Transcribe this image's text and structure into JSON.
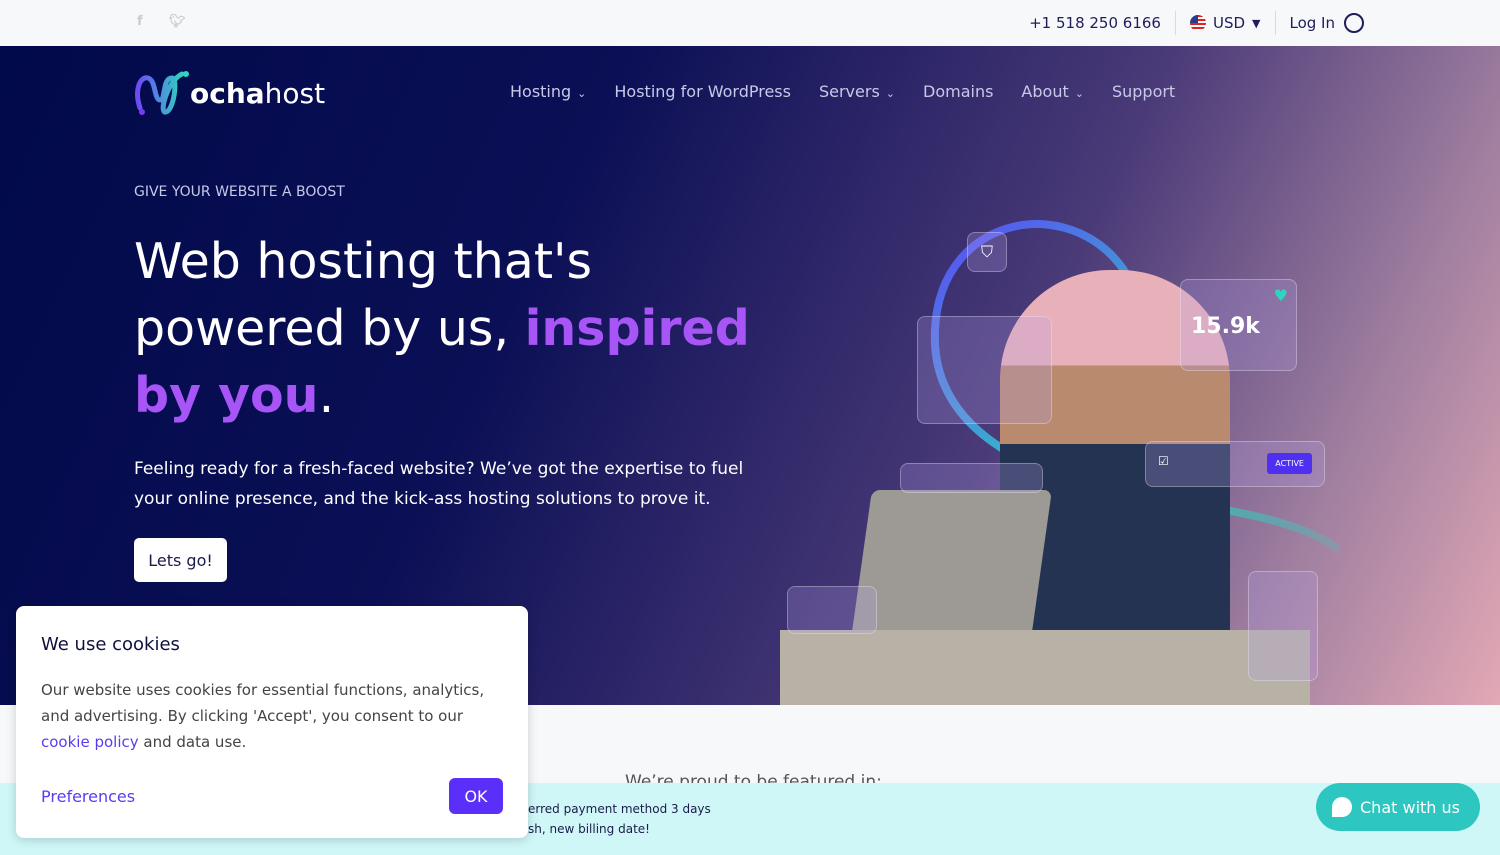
{
  "topbar": {
    "phone": "+1 518 250 6166",
    "currency": "USD",
    "login": "Log In",
    "social": [
      "facebook-icon",
      "twitter-icon"
    ]
  },
  "brand": {
    "name_bold": "ocha",
    "name_light": "host"
  },
  "nav": [
    {
      "label": "Hosting",
      "dropdown": true
    },
    {
      "label": "Hosting for WordPress",
      "dropdown": false
    },
    {
      "label": "Servers",
      "dropdown": true
    },
    {
      "label": "Domains",
      "dropdown": false
    },
    {
      "label": "About",
      "dropdown": true
    },
    {
      "label": "Support",
      "dropdown": false
    }
  ],
  "hero": {
    "eyebrow": "GIVE YOUR WEBSITE A BOOST",
    "title_1": "Web hosting that's powered by us, ",
    "title_accent": "inspired by you",
    "title_end": ".",
    "lead": "Feeling ready for a fresh-faced website? We’ve got the expertise to fuel your online presence, and the kick-ass hosting solutions to prove it.",
    "cta": "Lets go!",
    "stat": "15.9k",
    "badge": "ACTIVE"
  },
  "featured": "We’re proud to be featured in:",
  "banner": {
    "line1": "erred payment method 3 days",
    "line2": "sh, new billing date!"
  },
  "cookie": {
    "title": "We use cookies",
    "text": "Our website uses cookies for essential functions, analytics, and advertising. By clicking 'Accept', you consent to our ",
    "link": "cookie policy",
    "text_end": " and data use.",
    "preferences": "Preferences",
    "ok": "OK"
  },
  "chat": {
    "label": "Chat with us"
  },
  "colors": {
    "accent": "#a855f7",
    "button": "#5b2ffa",
    "chat": "#2dc6c0",
    "banner": "#cff7f7",
    "hero_dark": "#010a4a"
  }
}
